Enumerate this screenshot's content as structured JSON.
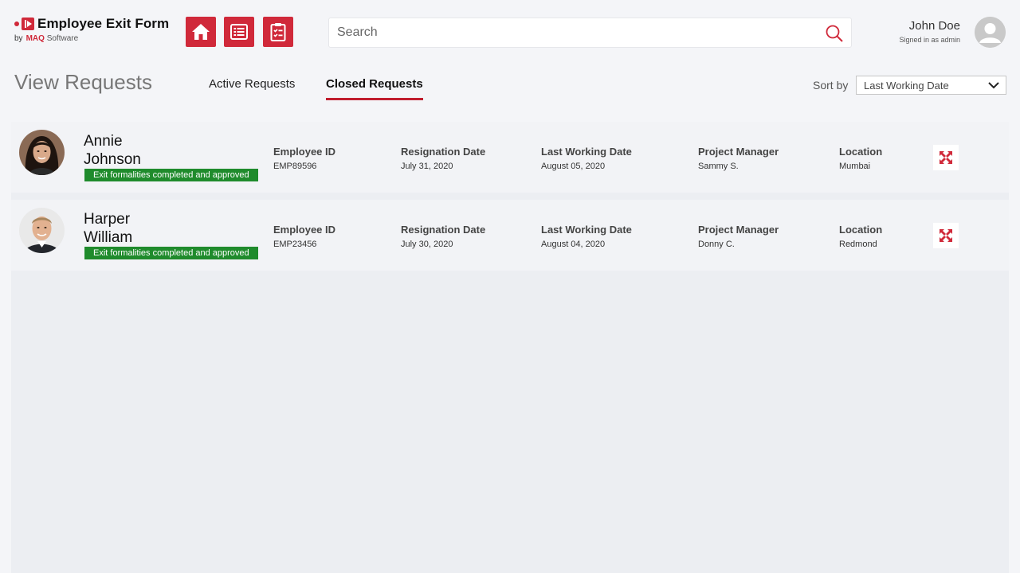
{
  "header": {
    "brand_title": "Employee Exit Form",
    "brand_by": "by",
    "brand_company": "MAQ",
    "brand_company_suffix": "Software",
    "nav": [
      {
        "icon": "home-icon"
      },
      {
        "icon": "list-icon"
      },
      {
        "icon": "clipboard-check-icon"
      }
    ],
    "search": {
      "placeholder": "Search",
      "value": ""
    },
    "user": {
      "name": "John Doe",
      "role": "Signed in as admin"
    }
  },
  "page": {
    "title": "View Requests",
    "tabs": [
      {
        "label": "Active Requests",
        "active": false
      },
      {
        "label": "Closed Requests",
        "active": true
      }
    ],
    "sort": {
      "label": "Sort by",
      "selected": "Last Working Date"
    }
  },
  "colors": {
    "accent": "#d0293a",
    "status_green": "#1f8b2c"
  },
  "requests": [
    {
      "first_name": "Annie",
      "last_name": "Johnson",
      "status": "Exit formalities completed and approved",
      "fields": {
        "employee_id_label": "Employee ID",
        "employee_id": "EMP89596",
        "resignation_label": "Resignation Date",
        "resignation_date": "July 31, 2020",
        "lwd_label": "Last Working Date",
        "last_working_date": "August 05, 2020",
        "pm_label": "Project Manager",
        "project_manager": "Sammy S.",
        "location_label": "Location",
        "location": "Mumbai"
      }
    },
    {
      "first_name": "Harper",
      "last_name": "William",
      "status": "Exit formalities completed and approved",
      "fields": {
        "employee_id_label": "Employee ID",
        "employee_id": "EMP23456",
        "resignation_label": "Resignation Date",
        "resignation_date": "July 30, 2020",
        "lwd_label": "Last Working Date",
        "last_working_date": "August 04, 2020",
        "pm_label": "Project Manager",
        "project_manager": "Donny C.",
        "location_label": "Location",
        "location": "Redmond"
      }
    }
  ]
}
